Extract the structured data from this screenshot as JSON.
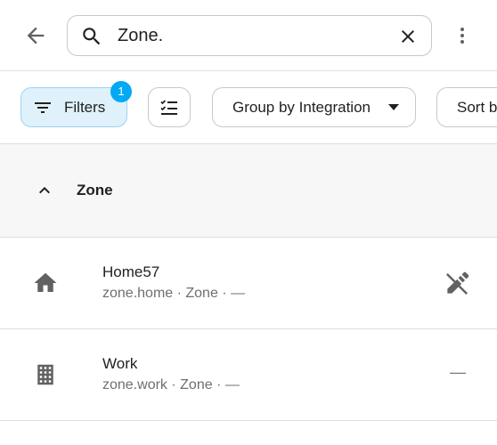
{
  "topbar": {
    "back_icon": "arrow-left-icon",
    "search": {
      "value": "Zone.",
      "icon": "search-icon"
    },
    "clear_icon": "close-icon",
    "more_icon": "more-vertical-icon"
  },
  "filters": {
    "filters_label": "Filters",
    "filters_badge": "1",
    "group_by_label": "Group by Integration",
    "sort_label": "Sort b"
  },
  "group": {
    "title": "Zone"
  },
  "rows": [
    {
      "title": "Home57",
      "subtitle": "zone.home · Zone · —",
      "icon": "home-icon",
      "action_icon": "pencil-off-icon"
    },
    {
      "title": "Work",
      "subtitle": "zone.work · Zone · —",
      "icon": "office-building-icon",
      "action_text": "—"
    }
  ],
  "colors": {
    "accent": "#03a9f4",
    "chip_active_bg": "#dff1fb",
    "icon_gray": "#616161"
  }
}
